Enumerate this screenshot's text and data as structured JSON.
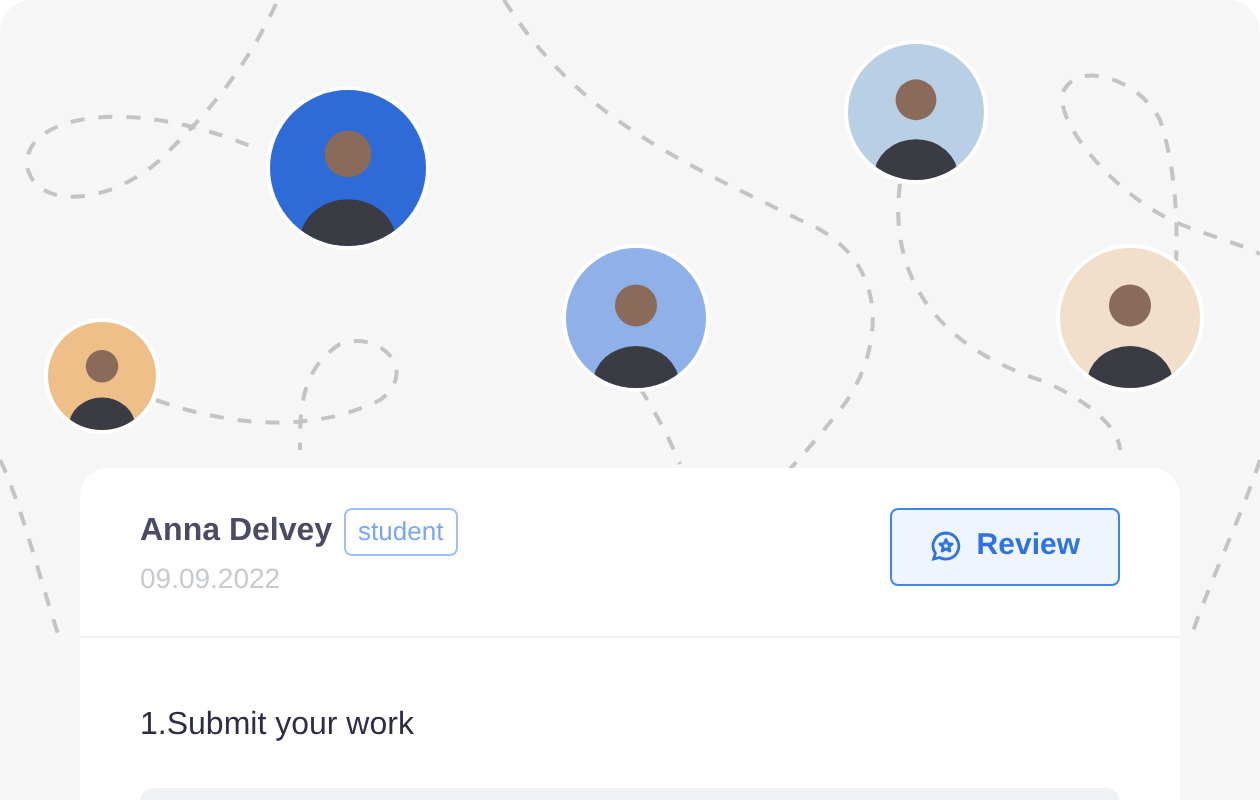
{
  "avatars": [
    {
      "color": "#2e6bd6"
    },
    {
      "color": "#b9cfe6"
    },
    {
      "color": "#8fb0e8"
    },
    {
      "color": "#efbf8a"
    },
    {
      "color": "#f1dfcb"
    }
  ],
  "card": {
    "name": "Anna Delvey",
    "badge": "student",
    "date": "09.09.2022",
    "button": "Review",
    "task": "1.Submit your work"
  }
}
